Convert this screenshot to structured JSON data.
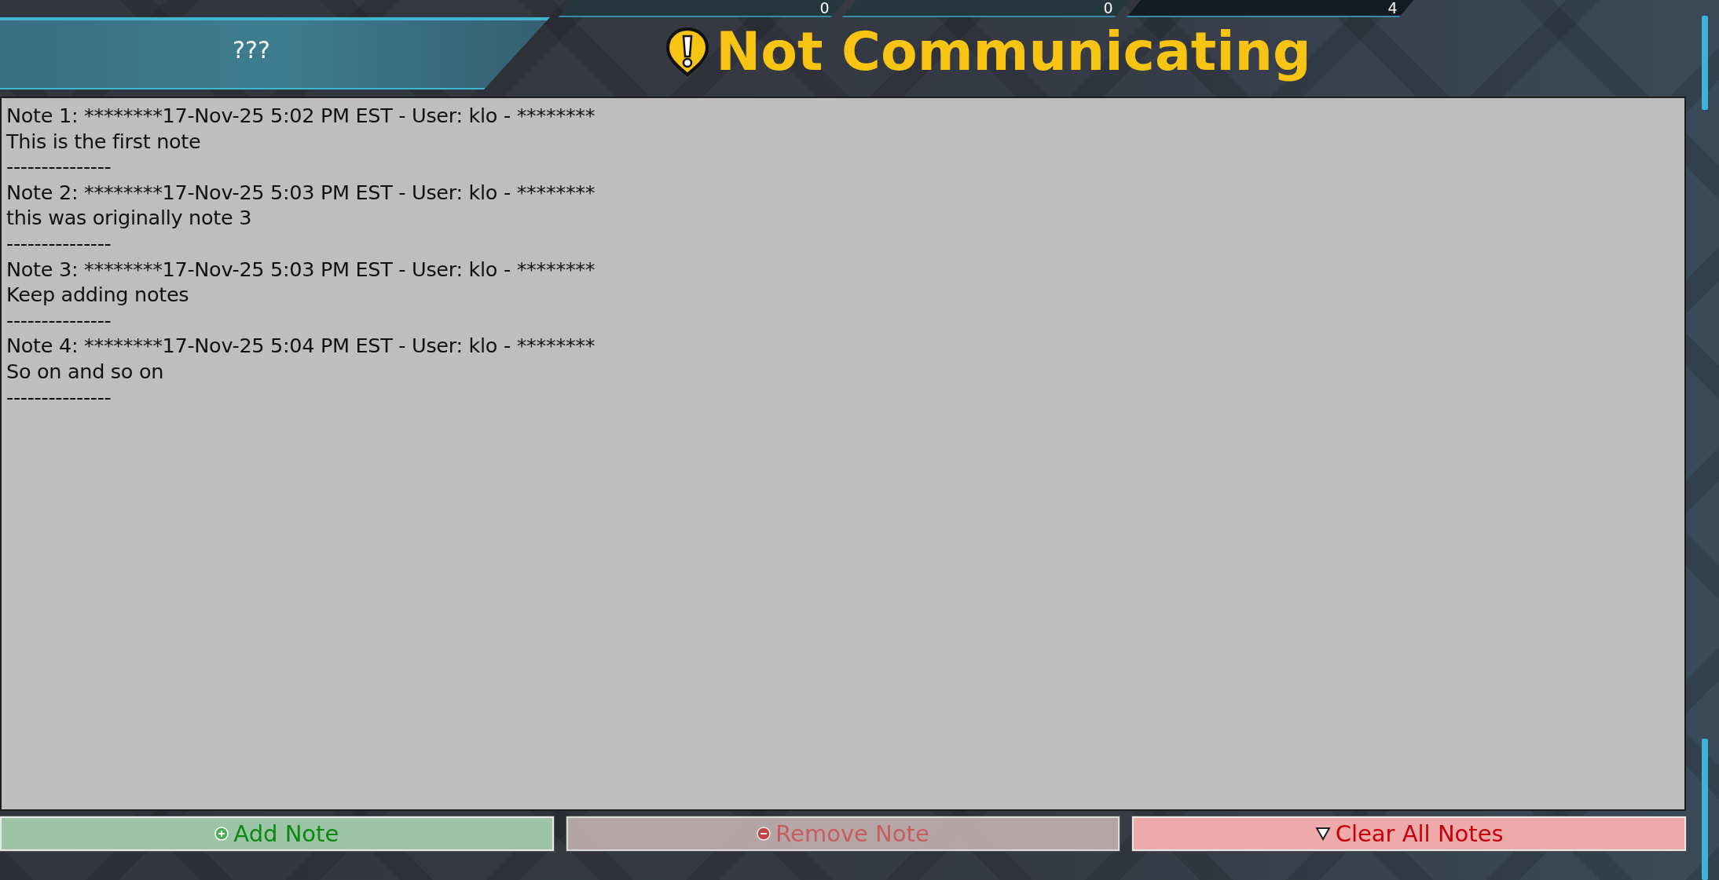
{
  "header": {
    "label": "???",
    "title": "Not Communicating"
  },
  "counters": [
    {
      "value": "0",
      "dark": false
    },
    {
      "value": "0",
      "dark": false
    },
    {
      "value": "4",
      "dark": true
    }
  ],
  "notes": [
    {
      "header": "Note 1: ********17-Nov-25 5:02 PM EST - User: klo - ********",
      "body": "This is the first note",
      "separator": "---------------"
    },
    {
      "header": "Note 2: ********17-Nov-25 5:03 PM EST - User: klo - ********",
      "body": "this was originally note 3",
      "separator": "---------------"
    },
    {
      "header": "Note 3: ********17-Nov-25 5:03 PM EST - User: klo - ********",
      "body": "Keep adding notes",
      "separator": "---------------"
    },
    {
      "header": "Note 4: ********17-Nov-25 5:04 PM EST - User: klo - ********",
      "body": "So on and so on",
      "separator": "---------------"
    }
  ],
  "buttons": [
    {
      "label": "Add Note",
      "kind": "add",
      "disabled": false
    },
    {
      "label": "Remove Note",
      "kind": "remove",
      "disabled": true
    },
    {
      "label": "Clear All Notes",
      "kind": "clear",
      "disabled": false
    }
  ]
}
